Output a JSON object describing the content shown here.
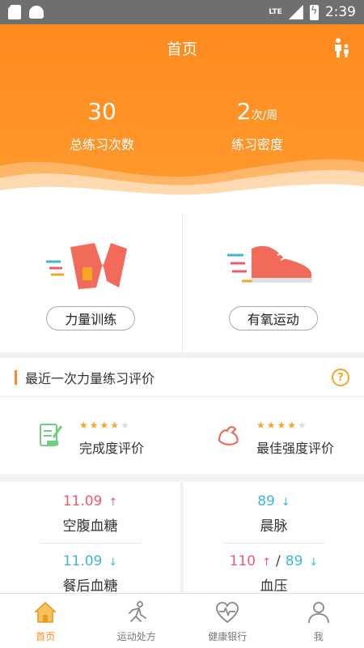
{
  "status_bar": {
    "network": "LTE",
    "time": "2:39"
  },
  "header": {
    "title": "首页",
    "stats": [
      {
        "value": "30",
        "unit": "",
        "label": "总练习次数"
      },
      {
        "value": "2",
        "unit": "次/周",
        "label": "练习密度"
      }
    ]
  },
  "cards": [
    {
      "label": "力量训练",
      "icon": "strength-band-icon"
    },
    {
      "label": "有氧运动",
      "icon": "running-shoe-icon"
    }
  ],
  "evaluation": {
    "title": "最近一次力量练习评价",
    "items": [
      {
        "label": "完成度评价",
        "stars_filled": 4,
        "stars_total": 5,
        "icon": "checklist-icon"
      },
      {
        "label": "最佳强度评价",
        "stars_filled": 4,
        "stars_total": 5,
        "icon": "muscle-icon"
      }
    ]
  },
  "metrics": {
    "fasting_glucose": {
      "value": "11.09",
      "arrow": "↑",
      "label": "空腹血糖"
    },
    "postmeal_glucose": {
      "value": "11.09",
      "arrow": "↓",
      "label": "餐后血糖"
    },
    "morning_pulse": {
      "value": "89",
      "arrow": "↓",
      "label": "晨脉"
    },
    "blood_pressure": {
      "systolic": "110",
      "systolic_arrow": "↑",
      "slash": "/",
      "diastolic": "89",
      "diastolic_arrow": "↓",
      "label": "血压"
    }
  },
  "tabs": [
    {
      "label": "首页",
      "icon": "home-icon",
      "active": true
    },
    {
      "label": "运动处方",
      "icon": "runner-icon",
      "active": false
    },
    {
      "label": "健康银行",
      "icon": "heart-pulse-icon",
      "active": false
    },
    {
      "label": "我",
      "icon": "person-icon",
      "active": false
    }
  ],
  "colors": {
    "accent": "#ff8a1e",
    "up": "#f05a6e",
    "down": "#3fb6d8",
    "star": "#f5a623"
  }
}
